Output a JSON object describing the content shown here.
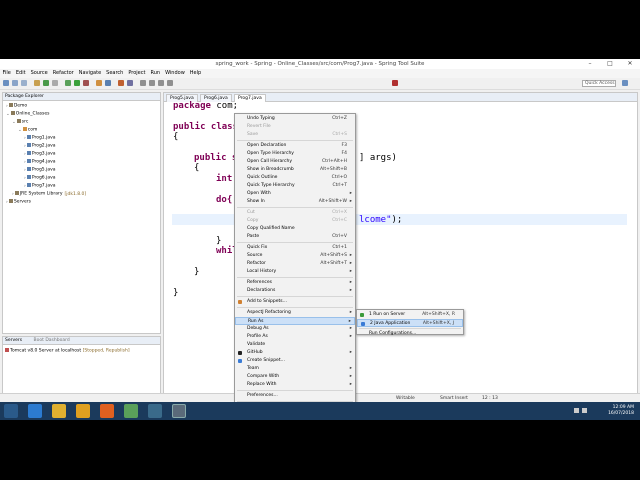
{
  "window": {
    "title": "spring_work - Spring - Online_Classes/src/com/Prog7.java - Spring Tool Suite"
  },
  "menubar": [
    "File",
    "Edit",
    "Source",
    "Refactor",
    "Navigate",
    "Search",
    "Project",
    "Run",
    "Window",
    "Help"
  ],
  "toolbar": {
    "quick_access_placeholder": "Quick Access"
  },
  "package_explorer": {
    "tab_label": "Package Explorer",
    "items": [
      {
        "label": "Demo",
        "indent": 0,
        "arrow": "›"
      },
      {
        "label": "Online_Classes",
        "indent": 0,
        "arrow": "⌄"
      },
      {
        "label": "src",
        "indent": 1,
        "arrow": "⌄"
      },
      {
        "label": "com",
        "indent": 2,
        "arrow": "⌄"
      },
      {
        "label": "Prog1.java",
        "indent": 3,
        "arrow": "›"
      },
      {
        "label": "Prog2.java",
        "indent": 3,
        "arrow": "›"
      },
      {
        "label": "Prog3.java",
        "indent": 3,
        "arrow": "›"
      },
      {
        "label": "Prog4.java",
        "indent": 3,
        "arrow": "›"
      },
      {
        "label": "Prog5.java",
        "indent": 3,
        "arrow": "›"
      },
      {
        "label": "Prog6.java",
        "indent": 3,
        "arrow": "›"
      },
      {
        "label": "Prog7.java",
        "indent": 3,
        "arrow": "›"
      },
      {
        "label": "JRE System Library",
        "suffix": "[jdk1.8.0]",
        "indent": 1,
        "arrow": "›"
      },
      {
        "label": "Servers",
        "indent": 0,
        "arrow": "›"
      }
    ]
  },
  "servers_panel": {
    "tab_servers": "Servers",
    "tab_boot": "Boot Dashboard",
    "server_name": "Tomcat v8.0 Server at localhost",
    "server_status": "[Stopped, Republish]"
  },
  "editor": {
    "tabs": [
      "Prog5.java",
      "Prog6.java",
      "Prog7.java"
    ],
    "active_tab": 2,
    "lines": {
      "l1_kw": "package",
      "l1_rest": " com;",
      "l2_kw": "public class",
      "l3": "{",
      "l4_kw": "public s",
      "l4_rest": "] args)",
      "l5": "{",
      "l6_kw": "int",
      "l7_kw": "do{",
      "l8_str": "lcome\"",
      "l8_rest": ");",
      "l9": "}",
      "l10_kw": "whil",
      "l11": "}",
      "l12": "}"
    }
  },
  "context_menu": {
    "items": [
      {
        "label": "Undo Typing",
        "acc": "Ctrl+Z"
      },
      {
        "label": "Revert File",
        "disabled": true
      },
      {
        "label": "Save",
        "acc": "Ctrl+S",
        "disabled": true
      },
      {
        "sep": true
      },
      {
        "label": "Open Declaration",
        "acc": "F3"
      },
      {
        "label": "Open Type Hierarchy",
        "acc": "F4"
      },
      {
        "label": "Open Call Hierarchy",
        "acc": "Ctrl+Alt+H"
      },
      {
        "label": "Show in Breadcrumb",
        "acc": "Alt+Shift+B"
      },
      {
        "label": "Quick Outline",
        "acc": "Ctrl+O"
      },
      {
        "label": "Quick Type Hierarchy",
        "acc": "Ctrl+T"
      },
      {
        "label": "Open With",
        "arrow": true
      },
      {
        "label": "Show In",
        "acc": "Alt+Shift+W",
        "arrow": true
      },
      {
        "sep": true
      },
      {
        "label": "Cut",
        "acc": "Ctrl+X",
        "disabled": true
      },
      {
        "label": "Copy",
        "acc": "Ctrl+C",
        "disabled": true
      },
      {
        "label": "Copy Qualified Name"
      },
      {
        "label": "Paste",
        "acc": "Ctrl+V"
      },
      {
        "sep": true
      },
      {
        "label": "Quick Fix",
        "acc": "Ctrl+1"
      },
      {
        "label": "Source",
        "acc": "Alt+Shift+S",
        "arrow": true
      },
      {
        "label": "Refactor",
        "acc": "Alt+Shift+T",
        "arrow": true
      },
      {
        "label": "Local History",
        "arrow": true
      },
      {
        "sep": true
      },
      {
        "label": "References",
        "arrow": true
      },
      {
        "label": "Declarations",
        "arrow": true
      },
      {
        "sep": true
      },
      {
        "label": "Add to Snippets...",
        "icon": "#d08030"
      },
      {
        "sep": true
      },
      {
        "label": "AspectJ Refactoring",
        "arrow": true
      },
      {
        "label": "Run As",
        "arrow": true,
        "selected": true
      },
      {
        "label": "Debug As",
        "arrow": true
      },
      {
        "label": "Profile As",
        "arrow": true
      },
      {
        "label": "Validate"
      },
      {
        "label": "GitHub",
        "arrow": true,
        "icon": "#222222"
      },
      {
        "label": "Create Snippet...",
        "icon": "#3a7bd5"
      },
      {
        "label": "Team",
        "arrow": true
      },
      {
        "label": "Compare With",
        "arrow": true
      },
      {
        "label": "Replace With",
        "arrow": true
      },
      {
        "sep": true
      },
      {
        "label": "Preferences..."
      },
      {
        "sep": true
      },
      {
        "label": "Remove from Context",
        "acc": "Ctrl+Alt+Shift+Down",
        "disabled": true
      }
    ]
  },
  "submenu": {
    "items": [
      {
        "label": "1 Run on Server",
        "acc": "Alt+Shift+X, R",
        "icon": "#3a9a3a"
      },
      {
        "label": "2 Java Application",
        "acc": "Alt+Shift+X, J",
        "icon": "#3a7bd5",
        "selected": true
      },
      {
        "sep": true
      },
      {
        "label": "Run Configurations..."
      }
    ]
  },
  "status": {
    "writable": "Writable",
    "insert": "Smart Insert",
    "position": "12 : 13"
  },
  "taskbar": {
    "time": "12:09 AM",
    "date": "16/07/2018"
  }
}
